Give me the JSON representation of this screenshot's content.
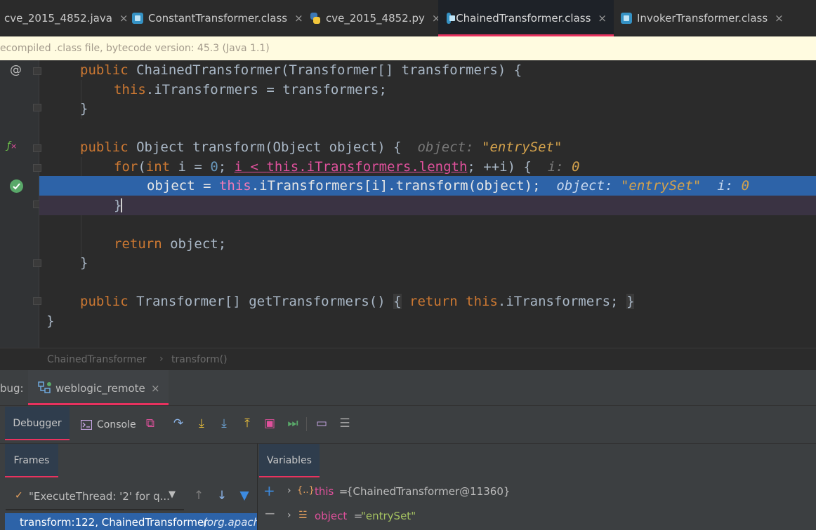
{
  "tabs": [
    {
      "label": "cve_2015_4852.java",
      "icon": "java-file-icon",
      "active": false
    },
    {
      "label": "ConstantTransformer.class",
      "icon": "class-file-icon",
      "active": false
    },
    {
      "label": "cve_2015_4852.py",
      "icon": "python-file-icon",
      "active": false
    },
    {
      "label": "ChainedTransformer.class",
      "icon": "class-file-icon",
      "active": true
    },
    {
      "label": "InvokerTransformer.class",
      "icon": "class-file-icon",
      "active": false
    }
  ],
  "tab_close": "×",
  "notice": "ecompiled .class file, bytecode version: 45.3 (Java 1.1)",
  "code": {
    "l1": {
      "kw": "public",
      "rest": " ChainedTransformer(Transformer[] transformers) {"
    },
    "l2": {
      "kw": "this",
      "rest": ".iTransformers = transformers;"
    },
    "l3": "}",
    "l5": {
      "kw": "public",
      "rest": " Object transform(Object object) {",
      "hint_name": "object:",
      "hint_val": "\"entrySet\""
    },
    "l6": {
      "kw1": "for",
      "p1": "(",
      "kw2": "int",
      "p2": " i = ",
      "num": "0",
      "p3": "; ",
      "cond": "i < ",
      "cond_kw": "this",
      "cond_fld": ".iTransformers.length",
      "p4": "; ++i) {",
      "hint_name": "i:",
      "hint_val": "0"
    },
    "l7": {
      "p1": "object = ",
      "kw": "this",
      "p2": ".iTransformers[i].transform(object);",
      "hint1_name": "object:",
      "hint1_val": "\"entrySet\"",
      "hint2_name": "i:",
      "hint2_val": "0"
    },
    "l8": "}",
    "l10": {
      "kw": "return",
      "rest": " object;"
    },
    "l11": "}",
    "l13": {
      "kw": "public",
      "p1": " Transformer[] getTransformers() ",
      "b1": "{",
      "kw2": "return",
      "kw3": "this",
      "p2": ".iTransformers;",
      "b2": "}"
    },
    "l14": "}"
  },
  "breadcrumb": {
    "class": "ChainedTransformer",
    "sep": "›",
    "method": "transform()"
  },
  "debug": {
    "label": "bug:",
    "session": "weblogic_remote",
    "close": "×",
    "tabs": {
      "debugger": "Debugger",
      "console": "Console"
    },
    "frames_label": "Frames",
    "variables_label": "Variables",
    "thread": "\"ExecuteThread: '2' for q...",
    "frame": "transform:122, ChainedTransformer",
    "frame_pkg": "(org.apach",
    "vars": [
      {
        "name": "this",
        "eq": " = ",
        "value": "{ChainedTransformer@11360}",
        "icon": "object-field-icon"
      },
      {
        "name": "object",
        "eq": " = ",
        "value": "\"entrySet\"",
        "icon": "parameter-icon"
      }
    ]
  },
  "colors": {
    "accent": "#e8325f",
    "exec_line": "#2d63a8",
    "keyword": "#cc7832",
    "string_hint": "#d4a24c"
  }
}
